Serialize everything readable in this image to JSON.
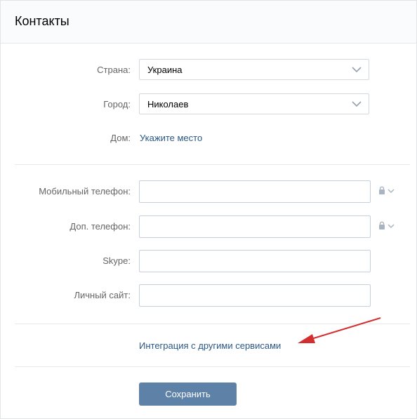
{
  "header": {
    "title": "Контакты"
  },
  "location": {
    "country": {
      "label": "Страна:",
      "value": "Украина"
    },
    "city": {
      "label": "Город:",
      "value": "Николаев"
    },
    "home": {
      "label": "Дом:",
      "link": "Укажите место"
    }
  },
  "contacts": {
    "mobile": {
      "label": "Мобильный телефон:",
      "value": ""
    },
    "extra_phone": {
      "label": "Доп. телефон:",
      "value": ""
    },
    "skype": {
      "label": "Skype:",
      "value": ""
    },
    "website": {
      "label": "Личный сайт:",
      "value": ""
    }
  },
  "integration": {
    "link": "Интеграция с другими сервисами"
  },
  "actions": {
    "save_label": "Сохранить"
  },
  "colors": {
    "link": "#2a5885",
    "button": "#5e81a8",
    "arrow": "#d32f2f",
    "header_bg": "#fafbfc"
  },
  "icons": {
    "dropdown": "chevron-down-icon",
    "privacy": "lock-icon"
  }
}
